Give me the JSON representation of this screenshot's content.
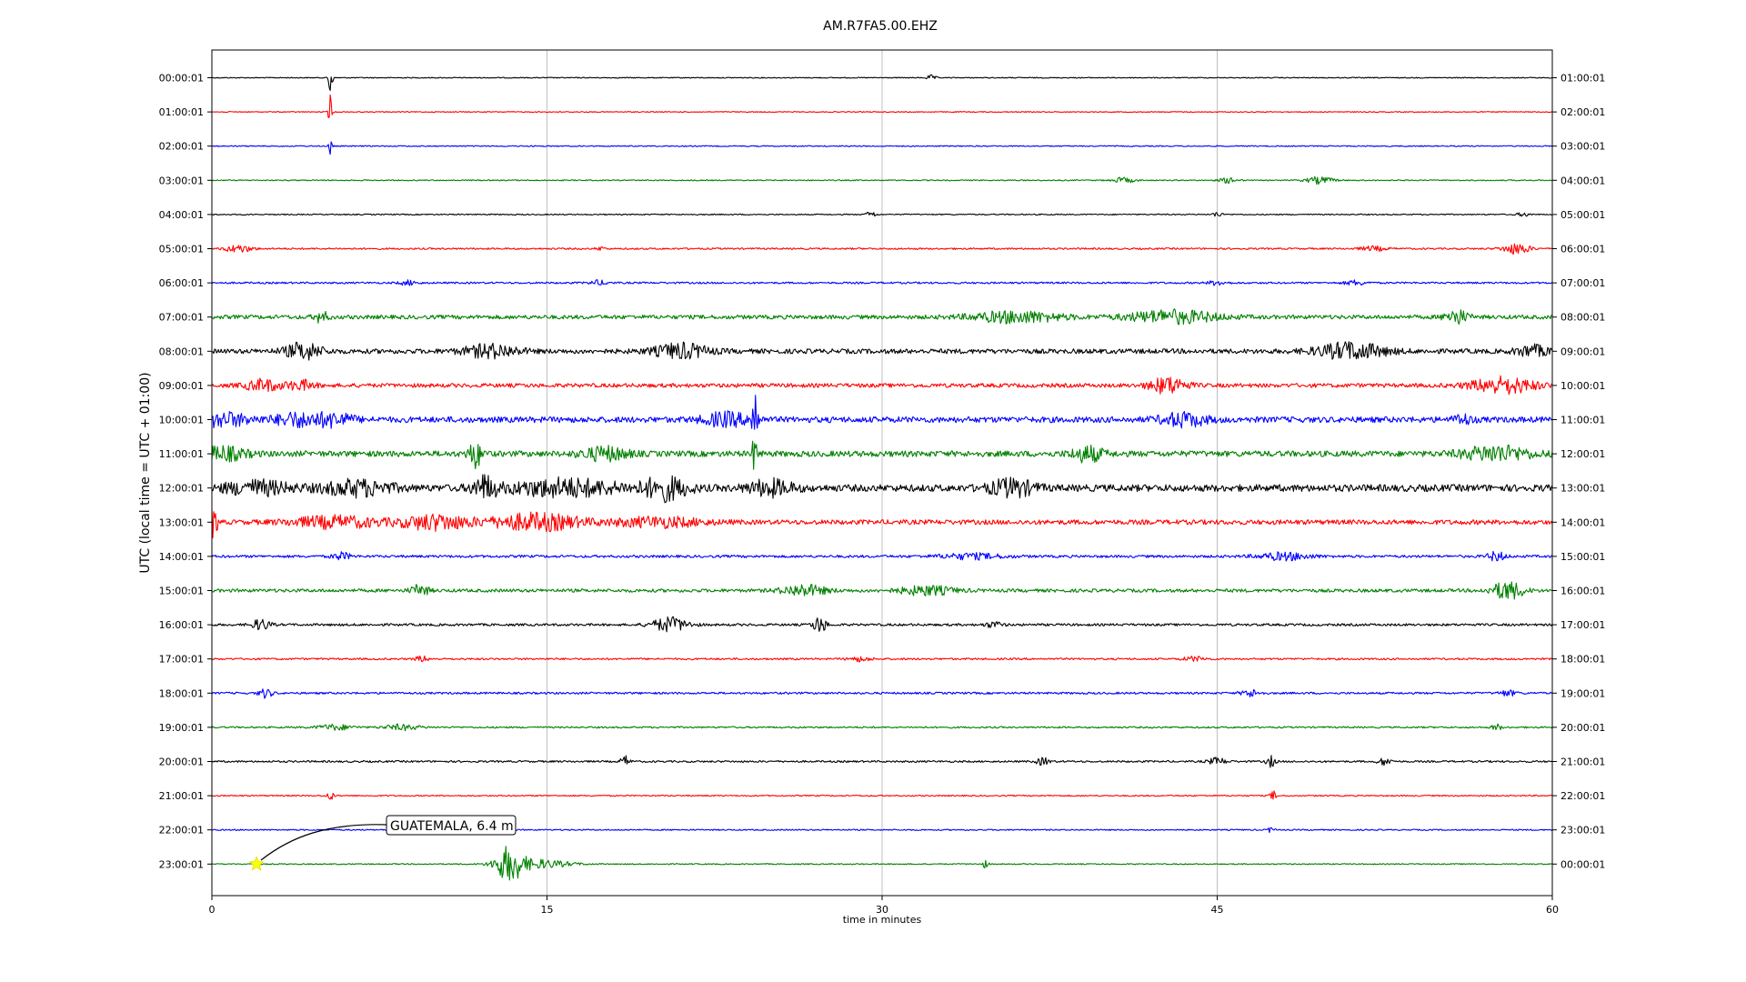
{
  "chart_data": {
    "type": "line",
    "title": "AM.R7FA5.00.EHZ",
    "xlabel": "time in minutes",
    "ylabel": "UTC (local time = UTC + 01:00)",
    "xlim": [
      0,
      60
    ],
    "xticks": [
      "0",
      "15",
      "30",
      "45",
      "60"
    ],
    "grid": "vertical",
    "left_labels": [
      "00:00:01",
      "01:00:01",
      "02:00:01",
      "03:00:01",
      "04:00:01",
      "05:00:01",
      "06:00:01",
      "07:00:01",
      "08:00:01",
      "09:00:01",
      "10:00:01",
      "11:00:01",
      "12:00:01",
      "13:00:01",
      "14:00:01",
      "15:00:01",
      "16:00:01",
      "17:00:01",
      "18:00:01",
      "19:00:01",
      "20:00:01",
      "21:00:01",
      "22:00:01",
      "23:00:01"
    ],
    "right_labels": [
      "01:00:01",
      "02:00:01",
      "03:00:01",
      "04:00:01",
      "05:00:01",
      "06:00:01",
      "07:00:01",
      "08:00:01",
      "09:00:01",
      "10:00:01",
      "11:00:01",
      "12:00:01",
      "13:00:01",
      "14:00:01",
      "15:00:01",
      "16:00:01",
      "17:00:01",
      "18:00:01",
      "19:00:01",
      "20:00:01",
      "21:00:01",
      "22:00:01",
      "23:00:01",
      "00:00:01"
    ],
    "trace_colors": [
      "#000000",
      "#ff0000",
      "#0000ff",
      "#008000"
    ],
    "annotation": {
      "text": "GUATEMALA, 6.4 m",
      "event_minute": 2,
      "event_row": 23,
      "marker": "star",
      "marker_color": "#ffff00"
    },
    "series": [
      {
        "row": 0,
        "noise": 0.5,
        "bursts": [
          [
            5.3,
            40,
            0.08
          ],
          [
            32.2,
            3,
            0.2
          ]
        ]
      },
      {
        "row": 1,
        "noise": 0.5,
        "bursts": [
          [
            5.3,
            20,
            0.08
          ]
        ]
      },
      {
        "row": 2,
        "noise": 0.6,
        "bursts": [
          [
            5.3,
            10,
            0.08
          ]
        ]
      },
      {
        "row": 3,
        "noise": 0.6,
        "bursts": [
          [
            40.8,
            3,
            0.5
          ],
          [
            45.5,
            3,
            0.4
          ],
          [
            49.6,
            4,
            0.6
          ]
        ]
      },
      {
        "row": 4,
        "noise": 0.6,
        "bursts": [
          [
            29.5,
            4,
            0.2
          ],
          [
            45.0,
            3,
            0.2
          ],
          [
            58.7,
            2,
            0.3
          ]
        ]
      },
      {
        "row": 5,
        "noise": 0.9,
        "bursts": [
          [
            1.2,
            4,
            0.6
          ],
          [
            17.4,
            2,
            0.2
          ],
          [
            52.0,
            2.5,
            0.6
          ],
          [
            58.4,
            6,
            0.6
          ]
        ]
      },
      {
        "row": 6,
        "noise": 1.0,
        "bursts": [
          [
            8.8,
            2.5,
            0.4
          ],
          [
            17.3,
            2.5,
            0.4
          ],
          [
            45.0,
            2.5,
            0.4
          ],
          [
            51.2,
            2.5,
            0.5
          ]
        ]
      },
      {
        "row": 7,
        "noise": 2.2,
        "bursts": [
          [
            4.9,
            6,
            0.3
          ],
          [
            36.0,
            6,
            2.0
          ],
          [
            43.0,
            7,
            2.0
          ],
          [
            55.7,
            8,
            0.5
          ]
        ]
      },
      {
        "row": 8,
        "noise": 2.6,
        "bursts": [
          [
            4.1,
            9,
            0.8
          ],
          [
            12.5,
            7,
            1.2
          ],
          [
            21.0,
            8,
            1.2
          ],
          [
            51.0,
            9,
            1.5
          ],
          [
            59.1,
            6,
            0.7
          ]
        ]
      },
      {
        "row": 9,
        "noise": 2.2,
        "bursts": [
          [
            2.3,
            6,
            0.8
          ],
          [
            4.0,
            5,
            0.6
          ],
          [
            42.8,
            9,
            0.8
          ],
          [
            57.8,
            9,
            1.4
          ]
        ]
      },
      {
        "row": 10,
        "noise": 3.2,
        "bursts": [
          [
            0.5,
            7,
            1.2
          ],
          [
            3.8,
            7,
            1.0
          ],
          [
            5.5,
            7,
            0.8
          ],
          [
            23.0,
            7,
            1.0
          ],
          [
            24.3,
            35,
            0.15
          ],
          [
            43.5,
            7,
            1.0
          ],
          [
            56.0,
            5,
            0.4
          ]
        ]
      },
      {
        "row": 11,
        "noise": 3.2,
        "bursts": [
          [
            0.5,
            7,
            1.0
          ],
          [
            11.8,
            14,
            0.3
          ],
          [
            17.6,
            7,
            1.0
          ],
          [
            24.3,
            20,
            0.12
          ],
          [
            39.2,
            8,
            0.7
          ],
          [
            57.5,
            8,
            1.5
          ]
        ]
      },
      {
        "row": 12,
        "noise": 3.8,
        "bursts": [
          [
            2.0,
            7,
            1.5
          ],
          [
            6.5,
            8,
            1.5
          ],
          [
            12.2,
            12,
            0.5
          ],
          [
            15.8,
            9,
            2.5
          ],
          [
            20.3,
            12,
            1.0
          ],
          [
            25.0,
            8,
            1.0
          ],
          [
            35.8,
            9,
            1.0
          ]
        ]
      },
      {
        "row": 13,
        "noise": 2.6,
        "bursts": [
          [
            0.1,
            18,
            0.15
          ],
          [
            5.5,
            6,
            2.0
          ],
          [
            10.0,
            8,
            1.5
          ],
          [
            14.5,
            9,
            2.0
          ],
          [
            20.0,
            5,
            2.0
          ]
        ]
      },
      {
        "row": 14,
        "noise": 1.4,
        "bursts": [
          [
            5.8,
            4,
            0.4
          ],
          [
            34.0,
            3,
            1.5
          ],
          [
            48.0,
            4,
            1.2
          ],
          [
            57.5,
            5,
            0.4
          ]
        ]
      },
      {
        "row": 15,
        "noise": 1.8,
        "bursts": [
          [
            9.3,
            6,
            0.4
          ],
          [
            26.5,
            6,
            1.0
          ],
          [
            32.0,
            5,
            1.2
          ],
          [
            58.0,
            10,
            0.7
          ]
        ]
      },
      {
        "row": 16,
        "noise": 1.3,
        "bursts": [
          [
            2.2,
            6,
            0.4
          ],
          [
            20.5,
            8,
            0.8
          ],
          [
            27.2,
            9,
            0.3
          ],
          [
            35.0,
            3,
            0.4
          ]
        ]
      },
      {
        "row": 17,
        "noise": 1.0,
        "bursts": [
          [
            9.4,
            3,
            0.3
          ],
          [
            29.0,
            2.5,
            0.5
          ],
          [
            44.0,
            2.5,
            0.5
          ]
        ]
      },
      {
        "row": 18,
        "noise": 1.1,
        "bursts": [
          [
            2.4,
            5,
            0.3
          ],
          [
            46.5,
            4,
            0.4
          ],
          [
            58.0,
            3,
            0.4
          ]
        ]
      },
      {
        "row": 19,
        "noise": 0.9,
        "bursts": [
          [
            5.5,
            3,
            0.8
          ],
          [
            8.5,
            3,
            0.8
          ],
          [
            57.5,
            4,
            0.2
          ]
        ]
      },
      {
        "row": 20,
        "noise": 1.0,
        "bursts": [
          [
            18.5,
            6,
            0.2
          ],
          [
            37.2,
            4,
            0.3
          ],
          [
            45.0,
            4,
            0.4
          ],
          [
            47.4,
            6,
            0.2
          ],
          [
            52.5,
            4,
            0.3
          ]
        ]
      },
      {
        "row": 21,
        "noise": 0.7,
        "bursts": [
          [
            5.3,
            5,
            0.15
          ],
          [
            47.5,
            5,
            0.15
          ]
        ]
      },
      {
        "row": 22,
        "noise": 0.7,
        "bursts": [
          [
            47.4,
            3,
            0.15
          ]
        ]
      },
      {
        "row": 23,
        "noise": 0.6,
        "bursts": [
          [
            13.3,
            18,
            0.6
          ],
          [
            14.5,
            5,
            1.5
          ],
          [
            34.6,
            4,
            0.15
          ]
        ]
      }
    ]
  }
}
